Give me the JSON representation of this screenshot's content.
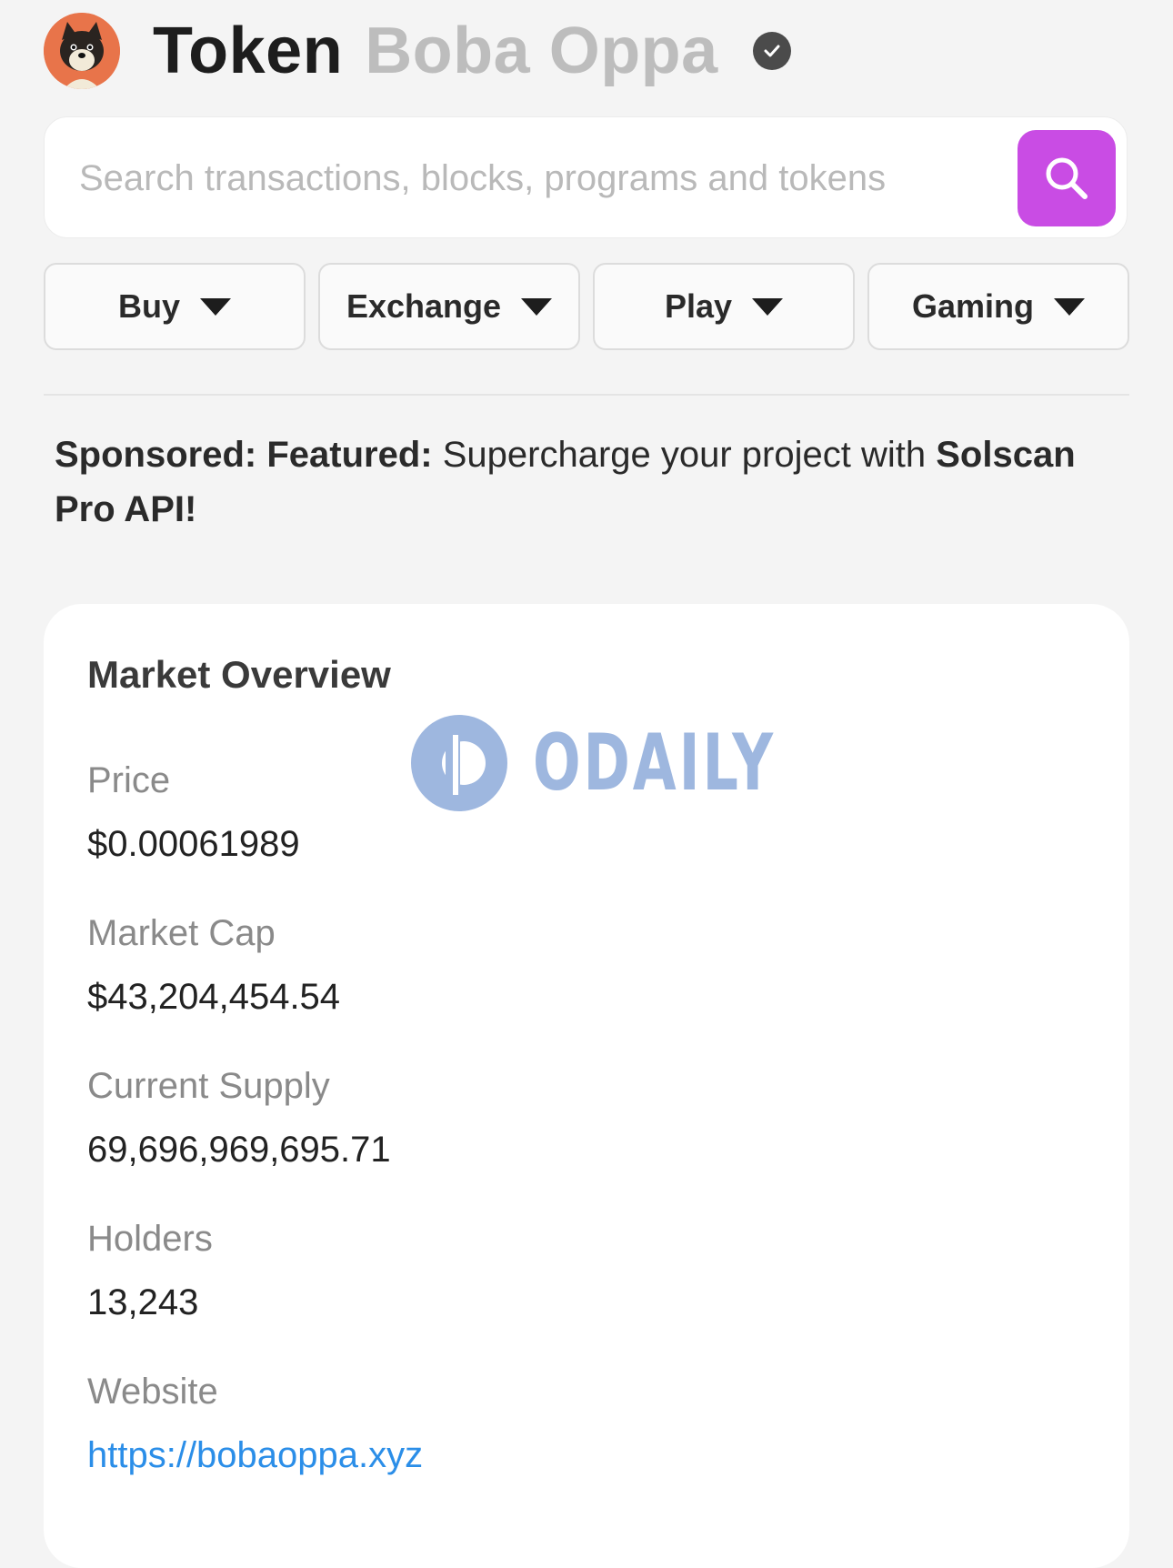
{
  "header": {
    "title_prefix": "Token",
    "token_name": "Boba Oppa"
  },
  "search": {
    "placeholder": "Search transactions, blocks, programs and tokens"
  },
  "nav": [
    {
      "label": "Buy"
    },
    {
      "label": "Exchange"
    },
    {
      "label": "Play"
    },
    {
      "label": "Gaming"
    }
  ],
  "sponsored": {
    "prefix": "Sponsored: Featured:",
    "text": "Supercharge your project with",
    "brand": "Solscan Pro API!"
  },
  "market": {
    "title": "Market Overview",
    "price_label": "Price",
    "price_value": "$0.00061989",
    "marketcap_label": "Market Cap",
    "marketcap_value": "$43,204,454.54",
    "supply_label": "Current Supply",
    "supply_value": "69,696,969,695.71",
    "holders_label": "Holders",
    "holders_value": "13,243",
    "website_label": "Website",
    "website_value": "https://bobaoppa.xyz"
  },
  "watermark": {
    "text": "ODAILY"
  },
  "colors": {
    "accent": "#c94ce4",
    "link": "#2b8ee8",
    "avatar_bg": "#e8744a"
  }
}
